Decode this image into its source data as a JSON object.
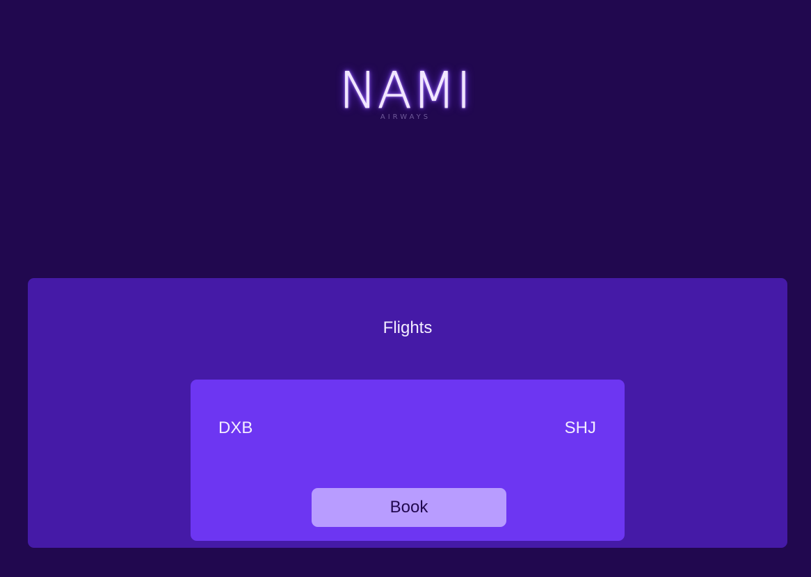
{
  "logo": {
    "wordmark": "NAMI",
    "subtitle": "AIRWAYS"
  },
  "flights": {
    "title": "Flights",
    "items": [
      {
        "origin": "DXB",
        "destination": "SHJ",
        "book_label": "Book"
      }
    ]
  },
  "colors": {
    "background": "#21084f",
    "panel": "#451aa7",
    "card": "#6d36f2",
    "button": "#b89cff"
  }
}
